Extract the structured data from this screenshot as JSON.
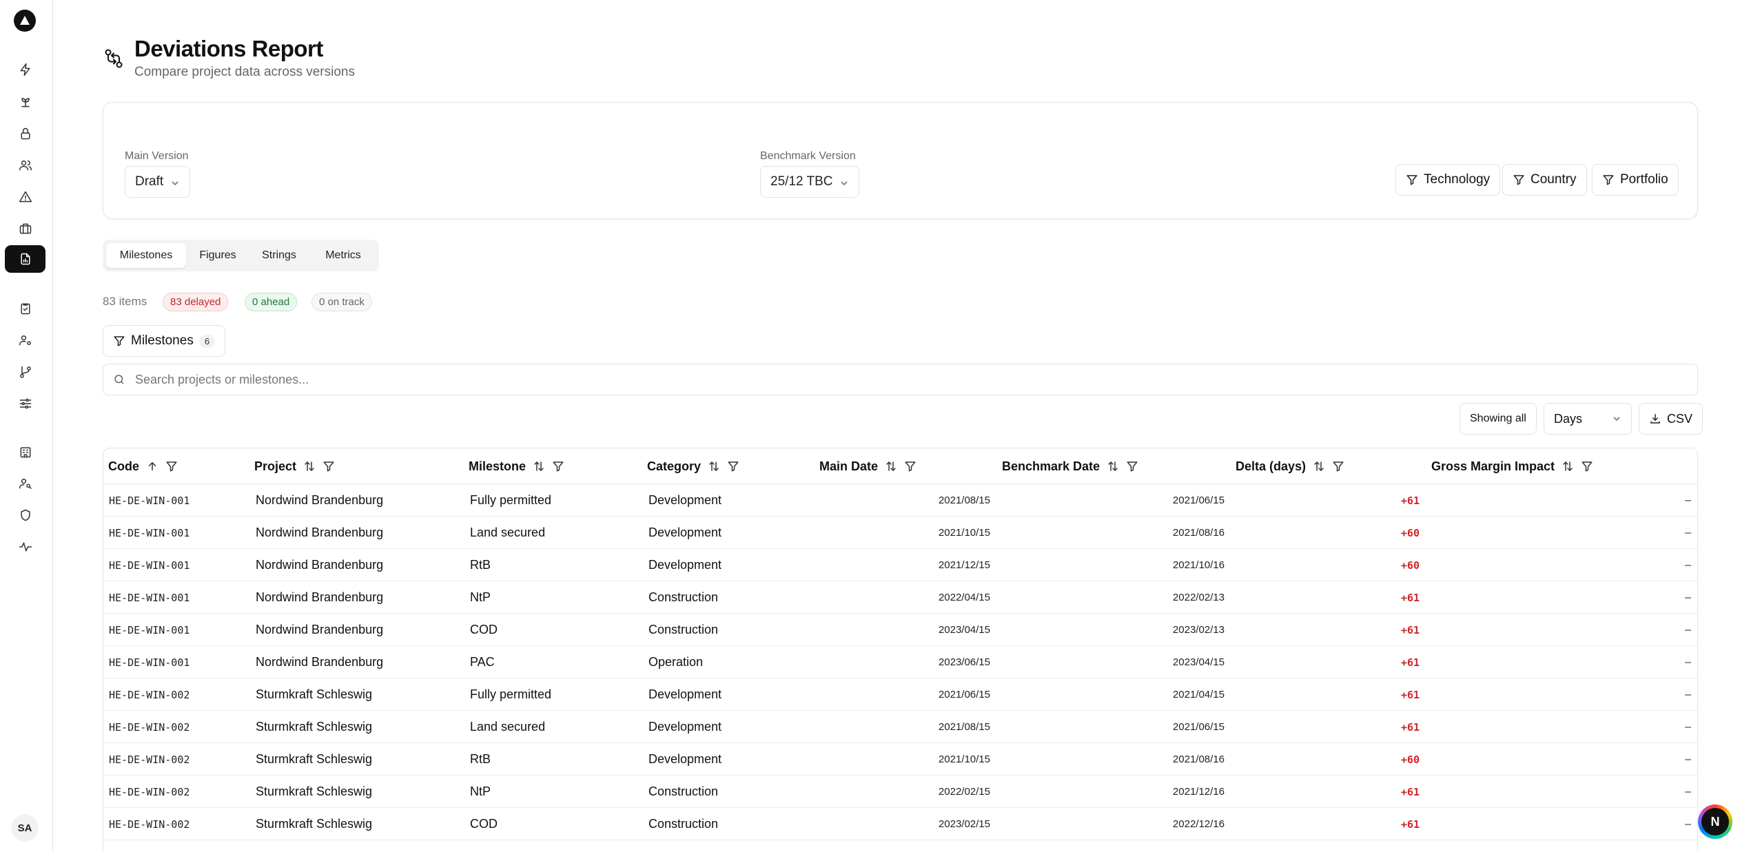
{
  "header": {
    "title": "Deviations Report",
    "subtitle": "Compare project data across versions"
  },
  "versions": {
    "main_label": "Main Version",
    "main_value": "Draft",
    "benchmark_label": "Benchmark Version",
    "benchmark_value": "25/12 TBC"
  },
  "filters": {
    "technology": "Technology",
    "country": "Country",
    "portfolio": "Portfolio"
  },
  "tabs": [
    {
      "label": "Milestones",
      "active": true
    },
    {
      "label": "Figures",
      "active": false
    },
    {
      "label": "Strings",
      "active": false
    },
    {
      "label": "Metrics",
      "active": false
    }
  ],
  "stats": {
    "items": "83 items",
    "delayed": "83 delayed",
    "ahead": "0 ahead",
    "on_track": "0 on track"
  },
  "milestone_filter": {
    "label": "Milestones",
    "count": "6"
  },
  "search": {
    "placeholder": "Search projects or milestones..."
  },
  "toolbar": {
    "showing_all": "Showing all",
    "unit": "Days",
    "csv": "CSV"
  },
  "table": {
    "columns": [
      "Code",
      "Project",
      "Milestone",
      "Category",
      "Main Date",
      "Benchmark Date",
      "Delta (days)",
      "Gross Margin Impact"
    ],
    "rows": [
      [
        "HE-DE-WIN-001",
        "Nordwind Brandenburg",
        "Fully permitted",
        "Development",
        "2021/08/15",
        "2021/06/15",
        "+61",
        "–"
      ],
      [
        "HE-DE-WIN-001",
        "Nordwind Brandenburg",
        "Land secured",
        "Development",
        "2021/10/15",
        "2021/08/16",
        "+60",
        "–"
      ],
      [
        "HE-DE-WIN-001",
        "Nordwind Brandenburg",
        "RtB",
        "Development",
        "2021/12/15",
        "2021/10/16",
        "+60",
        "–"
      ],
      [
        "HE-DE-WIN-001",
        "Nordwind Brandenburg",
        "NtP",
        "Construction",
        "2022/04/15",
        "2022/02/13",
        "+61",
        "–"
      ],
      [
        "HE-DE-WIN-001",
        "Nordwind Brandenburg",
        "COD",
        "Construction",
        "2023/04/15",
        "2023/02/13",
        "+61",
        "–"
      ],
      [
        "HE-DE-WIN-001",
        "Nordwind Brandenburg",
        "PAC",
        "Operation",
        "2023/06/15",
        "2023/04/15",
        "+61",
        "–"
      ],
      [
        "HE-DE-WIN-002",
        "Sturmkraft Schleswig",
        "Fully permitted",
        "Development",
        "2021/06/15",
        "2021/04/15",
        "+61",
        "–"
      ],
      [
        "HE-DE-WIN-002",
        "Sturmkraft Schleswig",
        "Land secured",
        "Development",
        "2021/08/15",
        "2021/06/15",
        "+61",
        "–"
      ],
      [
        "HE-DE-WIN-002",
        "Sturmkraft Schleswig",
        "RtB",
        "Development",
        "2021/10/15",
        "2021/08/16",
        "+60",
        "–"
      ],
      [
        "HE-DE-WIN-002",
        "Sturmkraft Schleswig",
        "NtP",
        "Construction",
        "2022/02/15",
        "2021/12/16",
        "+61",
        "–"
      ],
      [
        "HE-DE-WIN-002",
        "Sturmkraft Schleswig",
        "COD",
        "Construction",
        "2023/02/15",
        "2022/12/16",
        "+61",
        "–"
      ]
    ]
  },
  "user": {
    "initials": "SA"
  },
  "fab": {
    "label": "N"
  }
}
